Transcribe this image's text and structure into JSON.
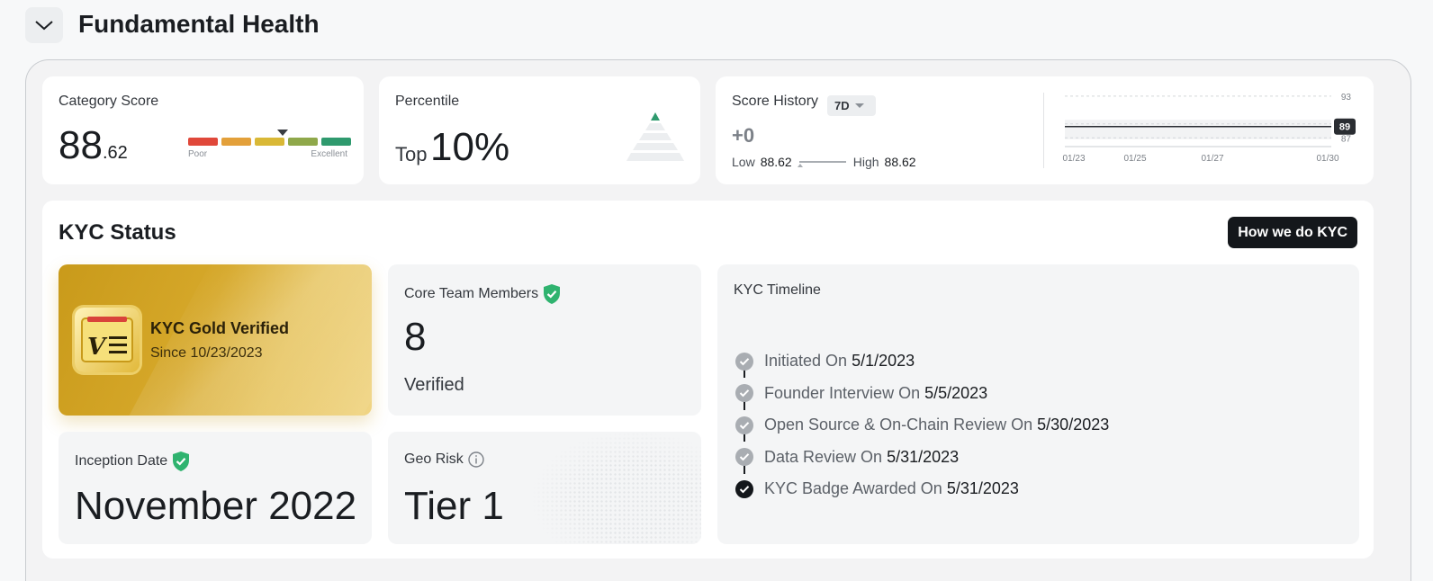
{
  "header": {
    "title": "Fundamental Health"
  },
  "category_score": {
    "label": "Category Score",
    "whole": "88",
    "decimal": ".62",
    "scale_low": "Poor",
    "scale_high": "Excellent"
  },
  "percentile": {
    "label": "Percentile",
    "prefix": "Top",
    "value": "10%"
  },
  "score_history": {
    "label": "Score History",
    "period": "7D",
    "change": "+0",
    "low_label": "Low",
    "low_value": "88.62",
    "high_label": "High",
    "high_value": "88.62",
    "chart_data": {
      "type": "line",
      "x": [
        "01/23",
        "01/25",
        "01/27",
        "01/30"
      ],
      "values": [
        88.62,
        88.62,
        88.62,
        88.62
      ],
      "yticks": [
        "93",
        "89",
        "87"
      ],
      "current_label": "89"
    }
  },
  "kyc": {
    "title": "KYC Status",
    "button": "How we do KYC",
    "badge": {
      "title": "KYC Gold Verified",
      "since": "Since 10/23/2023"
    },
    "core_team": {
      "label": "Core Team Members",
      "count": "8",
      "status": "Verified"
    },
    "inception": {
      "label": "Inception Date",
      "value": "November 2022"
    },
    "geo_risk": {
      "label": "Geo Risk",
      "value": "Tier 1"
    },
    "timeline": {
      "label": "KYC Timeline",
      "steps": [
        {
          "text": "Initiated On",
          "date": "5/1/2023"
        },
        {
          "text": "Founder Interview On",
          "date": "5/5/2023"
        },
        {
          "text": "Open Source & On-Chain Review On",
          "date": "5/30/2023"
        },
        {
          "text": "Data Review On",
          "date": "5/31/2023"
        },
        {
          "text": "KYC Badge Awarded On",
          "date": "5/31/2023"
        }
      ]
    }
  },
  "colors": {
    "scale": [
      "#e0483a",
      "#e3a03a",
      "#d9b836",
      "#8fa84a",
      "#2f9a6e"
    ],
    "verified": "#2fb36f",
    "dark": "#14171b"
  }
}
